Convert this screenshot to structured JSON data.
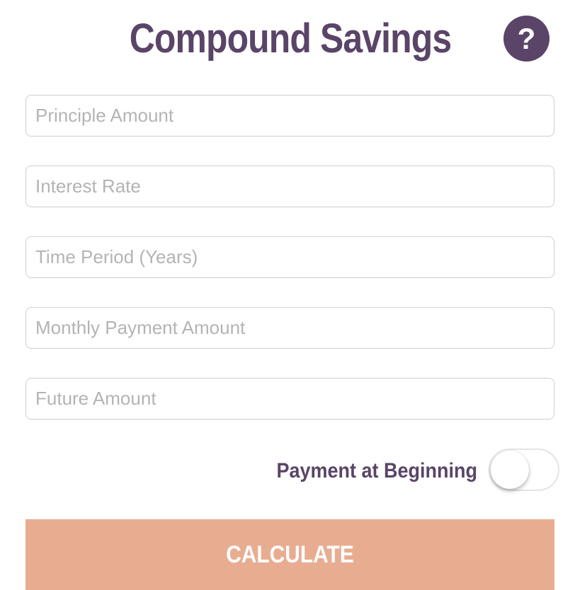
{
  "header": {
    "title": "Compound Savings",
    "help_label": "?"
  },
  "fields": [
    {
      "placeholder": "Principle Amount",
      "value": ""
    },
    {
      "placeholder": "Interest Rate",
      "value": ""
    },
    {
      "placeholder": "Time Period (Years)",
      "value": ""
    },
    {
      "placeholder": "Monthly Payment Amount",
      "value": ""
    },
    {
      "placeholder": "Future Amount",
      "value": ""
    }
  ],
  "payment_toggle": {
    "label": "Payment at Beginning",
    "on": false
  },
  "calculate": {
    "label": "CALCULATE"
  },
  "colors": {
    "brand_purple": "#5a4468",
    "accent_peach": "#e8ad90",
    "placeholder_gray": "#b4b4b4",
    "border_gray": "#cfcfcf"
  }
}
